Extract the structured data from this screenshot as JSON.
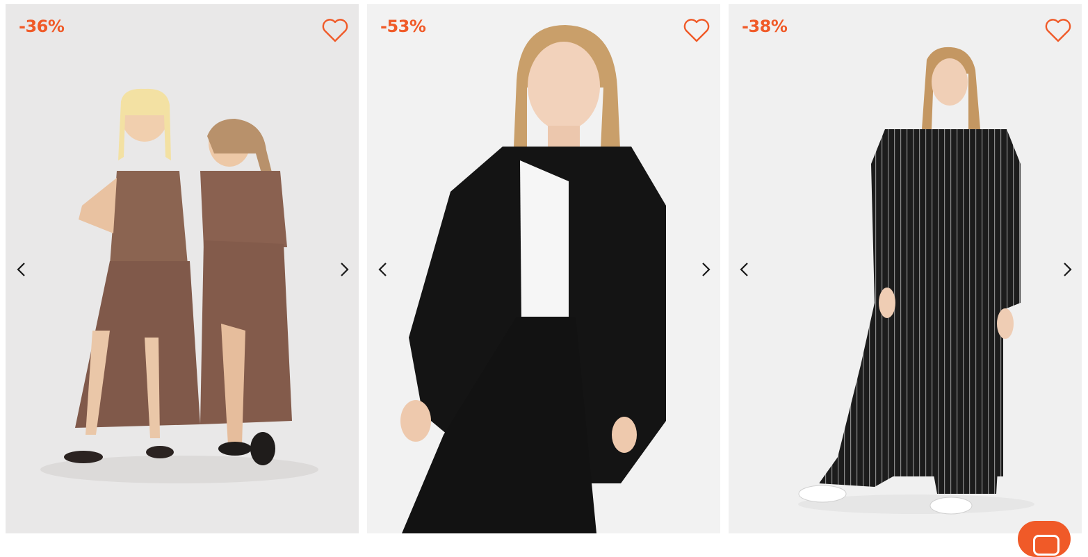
{
  "products": [
    {
      "discount": "-36%",
      "image": "two-women-brown-satin-outfits",
      "favorite_icon": "heart-outline-icon"
    },
    {
      "discount": "-53%",
      "image": "woman-black-shirt-wide-trousers",
      "favorite_icon": "heart-outline-icon"
    },
    {
      "discount": "-38%",
      "image": "woman-black-pinstripe-long-shirt-dress",
      "favorite_icon": "heart-outline-icon"
    }
  ],
  "colors": {
    "accent": "#f05a28",
    "card_bg": "#efefef",
    "icon": "#1a1a1a"
  },
  "chat_button": {
    "icon": "chat-icon"
  }
}
